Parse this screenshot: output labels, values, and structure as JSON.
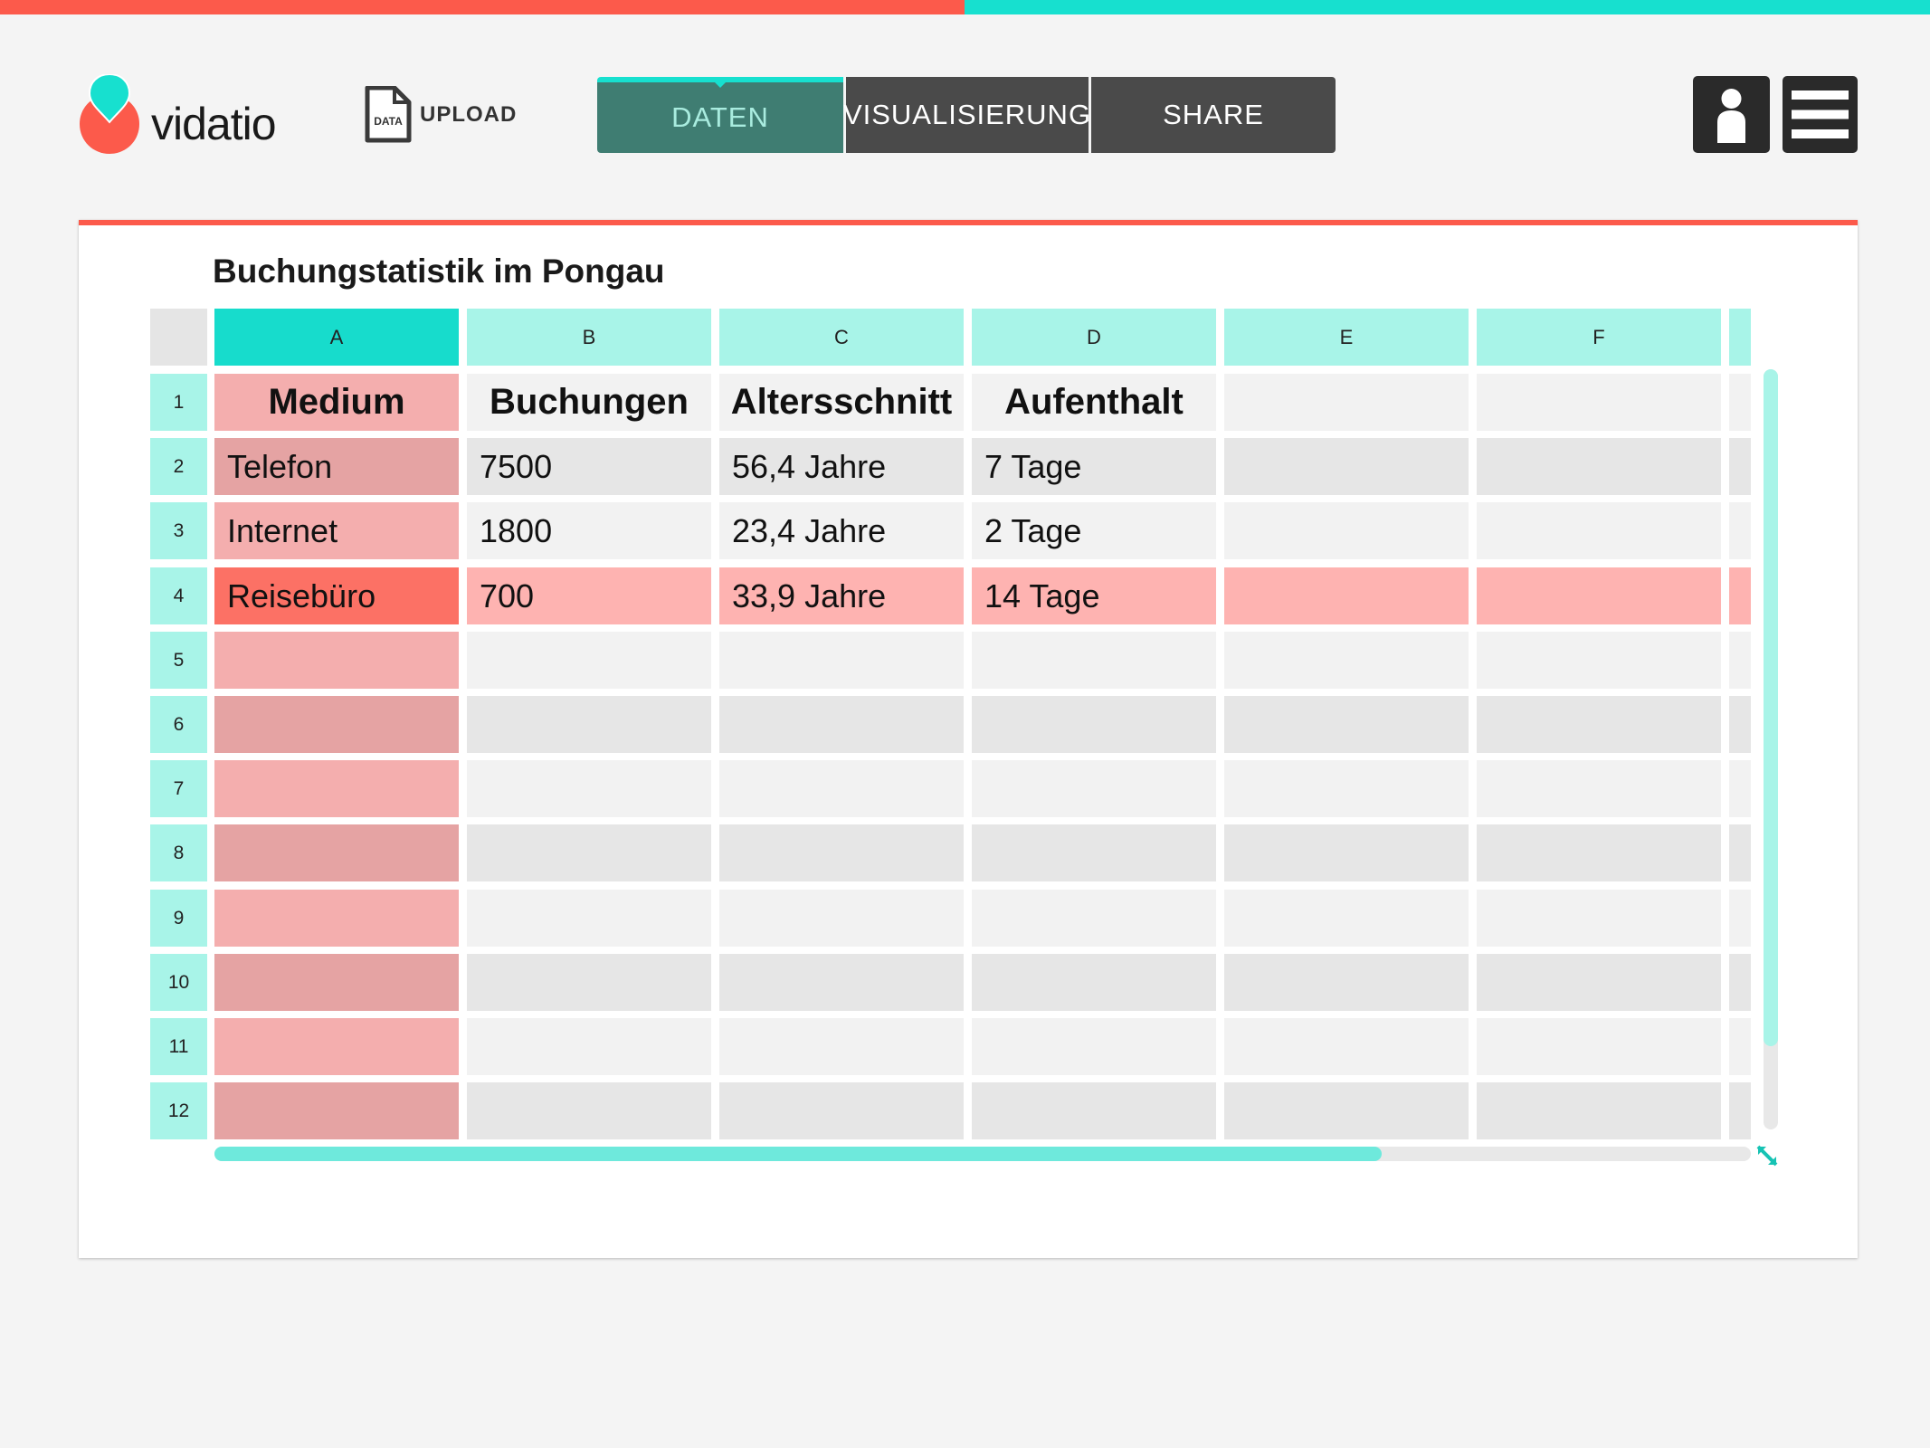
{
  "app": {
    "name": "vidatio"
  },
  "header": {
    "upload_label": "UPLOAD",
    "upload_icon_text": "DATA",
    "tabs": [
      {
        "label": "DATEN",
        "active": true
      },
      {
        "label": "VISUALISIERUNG",
        "active": false
      },
      {
        "label": "SHARE",
        "active": false
      }
    ],
    "user_icon": "user-icon",
    "menu_icon": "hamburger-menu-icon"
  },
  "sheet": {
    "title": "Buchungstatistik im Pongau",
    "columns": [
      "A",
      "B",
      "C",
      "D",
      "E",
      "F",
      ""
    ],
    "selected_column": "A",
    "highlighted_row": 4,
    "rows": [
      {
        "num": "1",
        "cells": [
          "Medium",
          "Buchungen",
          "Altersschnitt",
          "Aufenthalt",
          "",
          "",
          ""
        ]
      },
      {
        "num": "2",
        "cells": [
          "Telefon",
          "7500",
          "56,4 Jahre",
          "7 Tage",
          "",
          "",
          ""
        ]
      },
      {
        "num": "3",
        "cells": [
          "Internet",
          "1800",
          "23,4 Jahre",
          "2 Tage",
          "",
          "",
          ""
        ]
      },
      {
        "num": "4",
        "cells": [
          "Reisebüro",
          "700",
          "33,9 Jahre",
          "14 Tage",
          "",
          "",
          ""
        ]
      },
      {
        "num": "5",
        "cells": [
          "",
          "",
          "",
          "",
          "",
          "",
          ""
        ]
      },
      {
        "num": "6",
        "cells": [
          "",
          "",
          "",
          "",
          "",
          "",
          ""
        ]
      },
      {
        "num": "7",
        "cells": [
          "",
          "",
          "",
          "",
          "",
          "",
          ""
        ]
      },
      {
        "num": "8",
        "cells": [
          "",
          "",
          "",
          "",
          "",
          "",
          ""
        ]
      },
      {
        "num": "9",
        "cells": [
          "",
          "",
          "",
          "",
          "",
          "",
          ""
        ]
      },
      {
        "num": "10",
        "cells": [
          "",
          "",
          "",
          "",
          "",
          "",
          ""
        ]
      },
      {
        "num": "11",
        "cells": [
          "",
          "",
          "",
          "",
          "",
          "",
          ""
        ]
      },
      {
        "num": "12",
        "cells": [
          "",
          "",
          "",
          "",
          "",
          "",
          ""
        ]
      }
    ]
  },
  "scroll": {
    "horizontal_fraction": 0.76,
    "vertical_fraction": 0.89
  },
  "colors": {
    "accent_red": "#fc5a4b",
    "accent_teal": "#17e0cf",
    "active_tab": "#3f7d72",
    "column_a_light": "#f4aeae",
    "column_a_dark": "#e5a3a3",
    "highlight_row": "#feb3b1",
    "highlight_cell": "#fc7165",
    "cell_light": "#f2f2f2",
    "cell_dark": "#e6e6e6",
    "header_teal": "#a8f4e8"
  }
}
